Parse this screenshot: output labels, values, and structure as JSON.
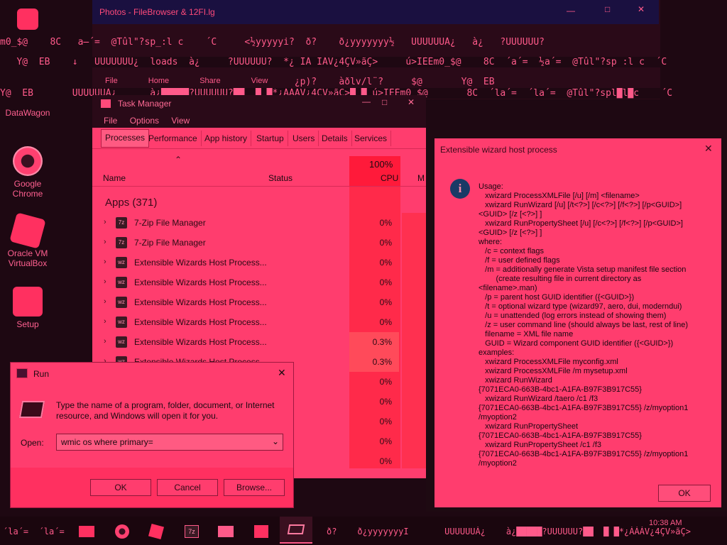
{
  "desktop": {
    "icons": [
      {
        "label": "DataWagon",
        "color": "#ff3060"
      },
      {
        "label": "Google\nChrome",
        "color": "#ff4070"
      },
      {
        "label": "Oracle VM\nVirtualBox",
        "color": "#ff3060"
      },
      {
        "label": "Setup",
        "color": "#ff3060"
      }
    ]
  },
  "explorer": {
    "title": "Photos - FileBrowser & 12FI.lg",
    "ribbon": [
      "File",
      "Home",
      "Share",
      "View"
    ],
    "garbage": [
      "m0_$@    8C   a̶´=  @Tûl\"?sp_:l c    ´C     <½yyyyyi?  ð?    ð¿yyyyyyy½   UUUUUUÀ¿   à¿   ?UUUUUU?",
      "   Y@  ËB    ↓   UUUUUUU¿  loads  à¿     ?UUUUUU?  *¿ IÁ IÁV¿4ÇV»ãÇ>     ú>IÈÈm0_$@    8C  ´a´=  ½a´=  @Tûl\"?sp :l c  ´C",
      "                                                     ¿p)?    àðlv/l¨?     $@       Y@  ËB",
      "Y@  ËB       UUUUUUÀ¿      à¿█████?UUUUUU?██  █ █*¿ÁÁÁV¿4ÇV»ãÇ>█ █ ú>IÈÈm0_$@       8C  ´la´=  ´la´=  @Tûl\"?spl█l█c    ´C"
    ]
  },
  "task_manager": {
    "title": "Task Manager",
    "menu": [
      "File",
      "Options",
      "View"
    ],
    "tabs": [
      "Processes",
      "Performance",
      "App history",
      "Startup",
      "Users",
      "Details",
      "Services"
    ],
    "columns": {
      "name": "Name",
      "status": "Status",
      "cpu_pct": "100%",
      "cpu": "CPU",
      "mem": "M"
    },
    "group": "Apps (371)",
    "rows": [
      {
        "name": "7-Zip File Manager",
        "icon": "7z",
        "cpu": "0%"
      },
      {
        "name": "7-Zip File Manager",
        "icon": "7z",
        "cpu": "0%"
      },
      {
        "name": "Extensible Wizards Host Process...",
        "icon": "wz",
        "cpu": "0%"
      },
      {
        "name": "Extensible Wizards Host Process...",
        "icon": "wz",
        "cpu": "0%"
      },
      {
        "name": "Extensible Wizards Host Process...",
        "icon": "wz",
        "cpu": "0%"
      },
      {
        "name": "Extensible Wizards Host Process...",
        "icon": "wz",
        "cpu": "0%"
      },
      {
        "name": "Extensible Wizards Host Process...",
        "icon": "wz",
        "cpu": "0.3%"
      },
      {
        "name": "Extensible Wizards Host Process",
        "icon": "wz",
        "cpu": "0.3%"
      },
      {
        "name": "",
        "icon": "",
        "cpu": "0%"
      },
      {
        "name": "",
        "icon": "",
        "cpu": "0%"
      },
      {
        "name": "",
        "icon": "",
        "cpu": "0%"
      },
      {
        "name": "",
        "icon": "",
        "cpu": "0%"
      },
      {
        "name": "",
        "icon": "",
        "cpu": "0%"
      }
    ]
  },
  "xwizard": {
    "title": "Extensible wizard host process",
    "body": "Usage:\n   xwizard ProcessXMLFile [/u] [/m] <filename>\n   xwizard RunWizard [/u] [/t<?>] [/c<?>] [/f<?>] [/p<GUID>]\n<GUID> [/z [<?>] ]\n   xwizard RunPropertySheet [/u] [/c<?>] [/f<?>] [/p<GUID>]\n<GUID> [/z [<?>] ]\nwhere:\n   /c = context flags\n   /f = user defined flags\n   /m = additionally generate Vista setup manifest file section\n        (create resulting file in current directory as\n<filename>.man)\n   /p = parent host GUID identifier ({<GUID>})\n   /t = optional wizard type (wizard97, aero, dui, moderndui)\n   /u = unattended (log errors instead of showing them)\n   /z = user command line (should always be last, rest of line)\n   filename = XML file name\n   GUID = Wizard component GUID identifier ({<GUID>})\nexamples:\n   xwizard ProcessXMLFile myconfig.xml\n   xwizard ProcessXMLFile /m mysetup.xml\n   xwizard RunWizard\n{7071ECA0-663B-4bc1-A1FA-B97F3B917C55}\n   xwizard RunWizard /taero /c1 /f3\n{7071ECA0-663B-4bc1-A1FA-B97F3B917C55} /z/myoption1\n/myoption2\n   xwizard RunPropertySheet\n{7071ECA0-663B-4bc1-A1FA-B97F3B917C55}\n   xwizard RunPropertySheet /c1 /f3\n{7071ECA0-663B-4bc1-A1FA-B97F3B917C55} /z/myoption1\n/myoption2",
    "ok_label": "OK"
  },
  "run_dialog": {
    "title": "Run",
    "description": "Type the name of a program, folder, document, or Internet resource, and Windows will open it for you.",
    "open_label": "Open:",
    "input_value": "wmic os where primary=",
    "ok_label": "OK",
    "cancel_label": "Cancel",
    "browse_label": "Browse..."
  },
  "taskbar": {
    "left_garbage": "´la´=  ´la´=",
    "right_garbage": "ð?    ð¿yyyyyyyI       UUUUUUÀ¿    à¿█████?UUUUUU?██  █ █*¿ÁÁÁV¿4ÇV»ãÇ>",
    "clock": "10:38 AM",
    "apps": [
      "file-explorer-icon",
      "chrome-icon",
      "virtualbox-icon",
      "7zip-icon",
      "photos-icon",
      "setup-icon",
      "run-icon"
    ]
  },
  "colors": {
    "accent": "#ff3d6e",
    "cpu_high": "#ff2a4a",
    "frame": "#1e0a12"
  }
}
